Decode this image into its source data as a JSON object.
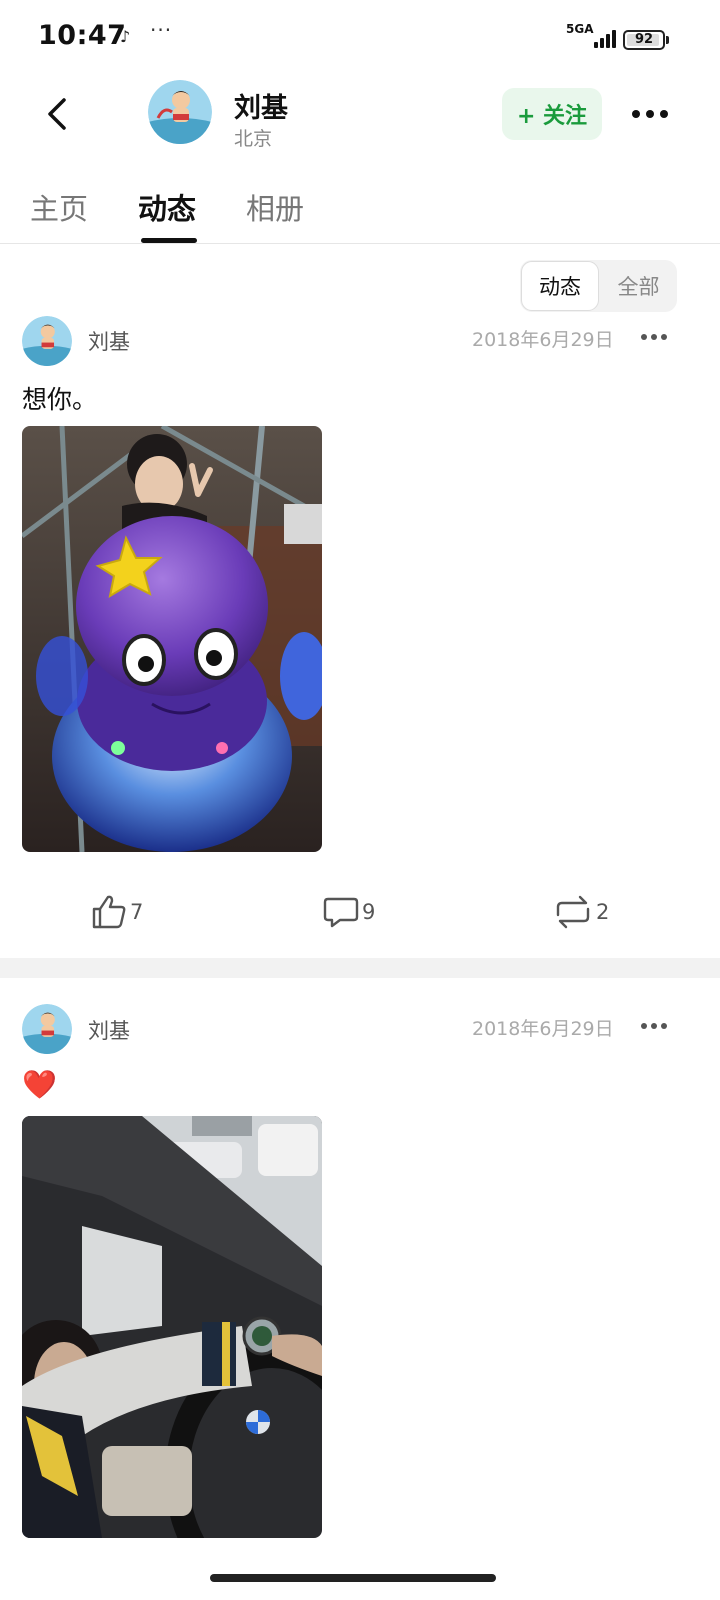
{
  "status_bar": {
    "time": "10:47",
    "app_icon": "tiktok-icon",
    "dots": "···",
    "network": "5GA",
    "battery": "92"
  },
  "header": {
    "name": "刘基",
    "location": "北京",
    "follow_label": "+ 关注",
    "accent_color": "#1a9b3c"
  },
  "tabs": [
    {
      "label": "主页",
      "active": false
    },
    {
      "label": "动态",
      "active": true
    },
    {
      "label": "相册",
      "active": false
    }
  ],
  "filter": {
    "active": "动态",
    "other": "全部"
  },
  "posts": [
    {
      "author": "刘基",
      "date": "2018年6月29日",
      "text": "想你。",
      "likes": "7",
      "comments": "9",
      "reposts": "2"
    },
    {
      "author": "刘基",
      "date": "2018年6月29日",
      "emoji": "❤️"
    }
  ]
}
